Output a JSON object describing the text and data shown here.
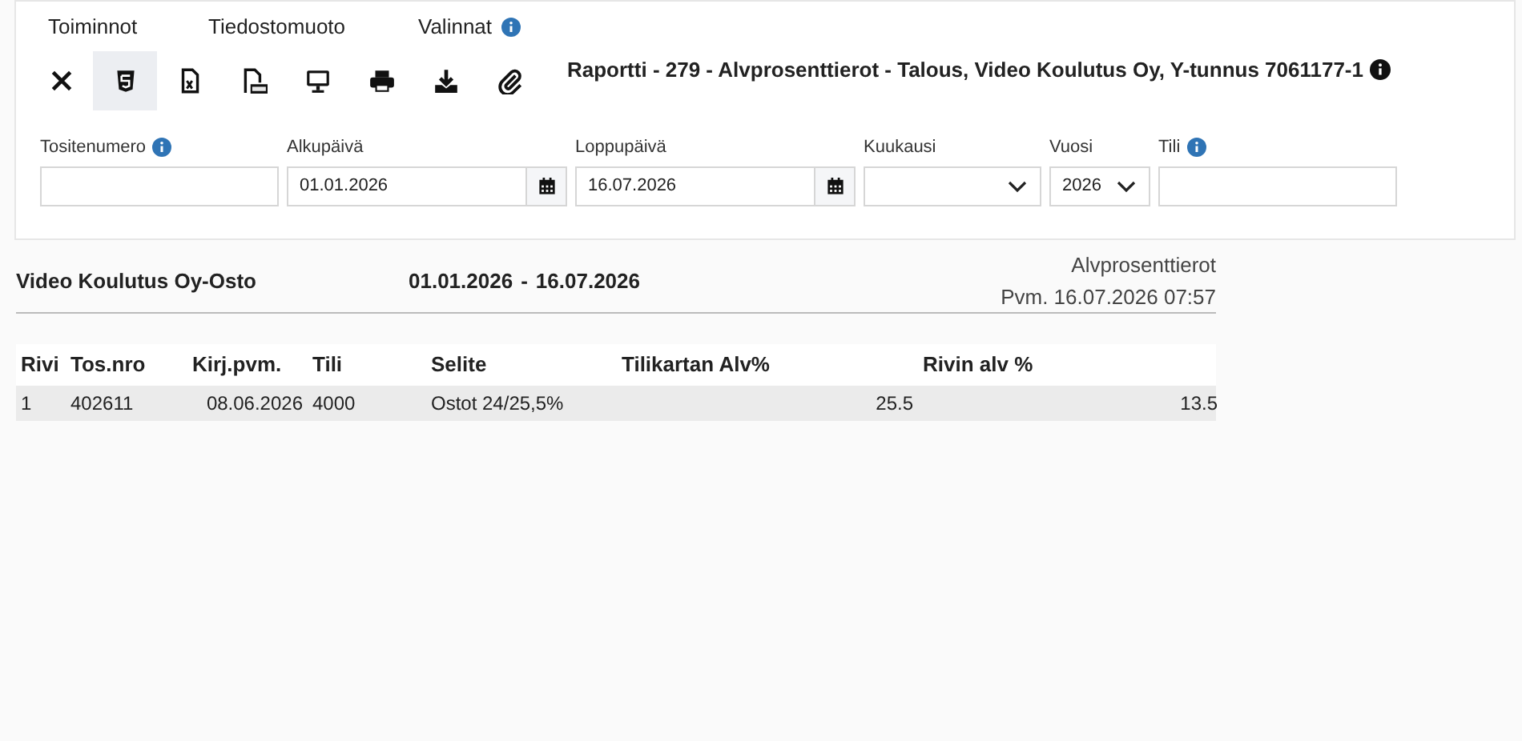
{
  "menu": [
    {
      "label": "Toiminnot",
      "info": false
    },
    {
      "label": "Tiedostomuoto",
      "info": false
    },
    {
      "label": "Valinnat",
      "info": true
    }
  ],
  "toolbar": [
    {
      "selected": false
    },
    {
      "selected": true
    },
    {
      "selected": false
    },
    {
      "selected": false
    },
    {
      "selected": false
    },
    {
      "selected": false
    },
    {
      "selected": false
    },
    {
      "selected": false
    }
  ],
  "report_title": "Raportti - 279 - Alvprosenttierot - Talous, Video Koulutus Oy, Y-tunnus 7061177-1",
  "filters": [
    {
      "kind": "text",
      "label": "Tositenumero",
      "info": true
    },
    {
      "kind": "date",
      "label": "Alkupäivä",
      "info": false,
      "value": "01.01.2026"
    },
    {
      "kind": "date",
      "label": "Loppupäivä",
      "info": false,
      "value": "16.07.2026"
    },
    {
      "kind": "select",
      "label": "Kuukausi",
      "info": false
    },
    {
      "kind": "select-small",
      "label": "Vuosi",
      "info": false,
      "value": "2026"
    },
    {
      "kind": "text",
      "label": "Tili",
      "info": true
    }
  ],
  "report": {
    "company": "Video Koulutus Oy-Osto",
    "date_from": "01.01.2026",
    "separator": "-",
    "date_to": "16.07.2026",
    "report_name": "Alvprosenttierot",
    "printed": "Pvm. 16.07.2026 07:57"
  },
  "table": {
    "columns": [
      "Rivi",
      "Tos.nro",
      "Kirj.pvm.",
      "Tili",
      "Selite",
      "Tilikartan Alv%",
      "Rivin alv %"
    ],
    "rows": [
      [
        "1",
        "402611",
        "08.06.2026",
        "4000",
        "Ostot 24/25,5%",
        "25.5",
        "13.5"
      ]
    ]
  }
}
